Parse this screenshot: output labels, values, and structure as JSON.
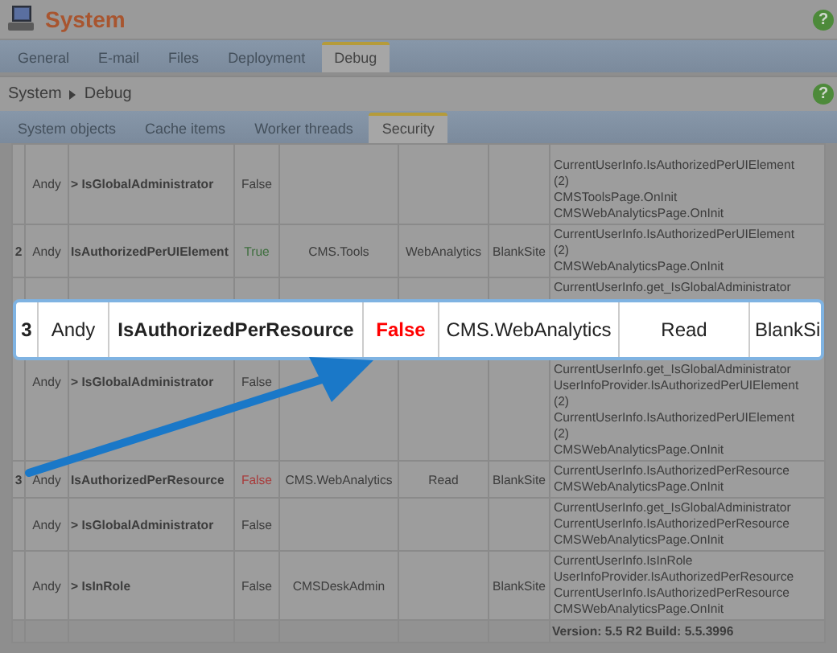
{
  "header": {
    "title": "System",
    "help": "?"
  },
  "tabs": [
    {
      "label": "General",
      "selected": false
    },
    {
      "label": "E-mail",
      "selected": false
    },
    {
      "label": "Files",
      "selected": false
    },
    {
      "label": "Deployment",
      "selected": false
    },
    {
      "label": "Debug",
      "selected": true
    }
  ],
  "breadcrumb": {
    "items": [
      "System",
      "Debug"
    ],
    "help": "?"
  },
  "subtabs": [
    {
      "label": "System objects",
      "selected": false
    },
    {
      "label": "Cache items",
      "selected": false
    },
    {
      "label": "Worker threads",
      "selected": false
    },
    {
      "label": "Security",
      "selected": true
    }
  ],
  "table": {
    "rows": [
      {
        "kind": "cut-top",
        "user": "Andy",
        "operation": "> IsGlobalAdministrator",
        "result": "False",
        "color": "#3c3c3c",
        "stack": [
          "CurrentUserInfo.IsAuthorizedPerUIElement",
          "(2)",
          "CMSToolsPage.OnInit",
          "CMSWebAnalyticsPage.OnInit"
        ]
      },
      {
        "kind": "plain",
        "index": "2",
        "user": "Andy",
        "operation": "IsAuthorizedPerUIElement",
        "result": "True",
        "color": "#3f6f3f",
        "resource": "CMS.Tools",
        "name": "WebAnalytics",
        "site": "BlankSite",
        "stack": [
          "CurrentUserInfo.IsAuthorizedPerUIElement",
          "(2)",
          "CMSWebAnalyticsPage.OnInit"
        ]
      },
      {
        "kind": "under-callout",
        "user": "Andy",
        "operation": "> IsGlobalAdministrator",
        "result": "False",
        "color": "#3c3c3c",
        "stack": [
          "CurrentUserInfo.get_IsGlobalAdministrator",
          "CurrentUserInfo.get_IsGlobalAdministrator",
          "UserInfoProvider.IsAuthorizedPerUIElement",
          "(2)",
          "CurrentUserInfo.IsAuthorizedPerUIElement",
          "(2)",
          "CMSWebAnalyticsPage.OnInit"
        ]
      },
      {
        "kind": "plain",
        "index": "3",
        "user": "Andy",
        "operation": "IsAuthorizedPerResource",
        "result": "False",
        "color": "#a83c3c",
        "resource": "CMS.WebAnalytics",
        "name": "Read",
        "site": "BlankSite",
        "stack": [
          "CurrentUserInfo.IsAuthorizedPerResource",
          "CMSWebAnalyticsPage.OnInit"
        ]
      },
      {
        "kind": "plain",
        "user": "Andy",
        "operation": "> IsGlobalAdministrator",
        "result": "False",
        "color": "#3c3c3c",
        "stack": [
          "CurrentUserInfo.get_IsGlobalAdministrator",
          "CurrentUserInfo.IsAuthorizedPerResource",
          "CMSWebAnalyticsPage.OnInit"
        ]
      },
      {
        "kind": "plain",
        "user": "Andy",
        "operation": "> IsInRole",
        "result": "False",
        "color": "#3c3c3c",
        "resource": "CMSDeskAdmin",
        "site": "BlankSite",
        "stack": [
          "CurrentUserInfo.IsInRole",
          "UserInfoProvider.IsAuthorizedPerResource",
          "CurrentUserInfo.IsAuthorizedPerResource",
          "CMSWebAnalyticsPage.OnInit"
        ]
      }
    ],
    "footer": "Version: 5.5 R2 Build: 5.5.3996"
  },
  "callout": {
    "index": "3",
    "user": "Andy",
    "operation": "IsAuthorizedPerResource",
    "result": "False",
    "color": "#ff0000",
    "resource": "CMS.WebAnalytics",
    "name": "Read",
    "site": "BlankSi"
  }
}
